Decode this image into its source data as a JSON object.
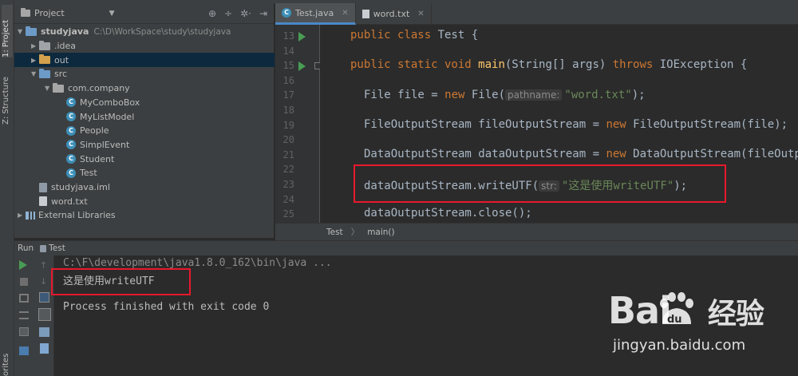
{
  "sidebar": {
    "project_tab": "1: Project",
    "structure_tab": "Z: Structure",
    "favorites_tab": "orites"
  },
  "project": {
    "header": "Project",
    "tree": [
      {
        "label": "studyjava",
        "path": "C:\\D\\WorkSpace\\study\\studyjava",
        "icon": "module-folder-icon",
        "arrow": "▼",
        "indent": 0
      },
      {
        "label": ".idea",
        "icon": "folder-icon",
        "arrow": "▶",
        "indent": 1
      },
      {
        "label": "out",
        "icon": "excluded-folder-icon",
        "arrow": "▶",
        "indent": 1,
        "selected": true
      },
      {
        "label": "src",
        "icon": "source-folder-icon",
        "arrow": "▼",
        "indent": 1
      },
      {
        "label": "com.company",
        "icon": "package-icon",
        "arrow": "▼",
        "indent": 2
      },
      {
        "label": "MyComboBox",
        "icon": "class-icon",
        "indent": 3
      },
      {
        "label": "MyListModel",
        "icon": "class-icon",
        "indent": 3
      },
      {
        "label": "People",
        "icon": "class-icon",
        "indent": 3
      },
      {
        "label": "SimplEvent",
        "icon": "class-icon",
        "indent": 3
      },
      {
        "label": "Student",
        "icon": "class-icon",
        "indent": 3
      },
      {
        "label": "Test",
        "icon": "class-icon",
        "indent": 3
      },
      {
        "label": "studyjava.iml",
        "icon": "iml-file-icon",
        "indent": 1
      },
      {
        "label": "word.txt",
        "icon": "text-file-icon",
        "indent": 1
      },
      {
        "label": "External Libraries",
        "icon": "libraries-icon",
        "arrow": "▶",
        "indent": 0
      }
    ]
  },
  "editor": {
    "tabs": [
      {
        "label": "Test.java",
        "active": true
      },
      {
        "label": "word.txt",
        "active": false
      }
    ],
    "line_numbers": [
      "13",
      "14",
      "15",
      "16",
      "17",
      "18",
      "19",
      "20",
      "21",
      "22",
      "23",
      "24",
      "25"
    ],
    "code": {
      "l13_kw": "public class ",
      "l13_rest": "Test {",
      "l15_kw": "public static void ",
      "l15_fn": "main",
      "l15_mid": "(String[] args) ",
      "l15_kw2": "throws ",
      "l15_rest": "IOException {",
      "l17_a": "File file = ",
      "l17_kw": "new ",
      "l17_b": "File(",
      "l17_hint": "pathname:",
      "l17_str": "\"word.txt\"",
      "l17_end": ");",
      "l19_a": "FileOutputStream fileOutputStream = ",
      "l19_kw": "new ",
      "l19_b": "FileOutputStream(file);",
      "l21_a": "DataOutputStream dataOutputStream = ",
      "l21_kw": "new ",
      "l21_b": "DataOutputStream(fileOutp",
      "l23_a": "dataOutputStream.writeUTF(",
      "l23_hint": "str:",
      "l23_str": "\"这是使用writeUTF\"",
      "l23_end": ");",
      "l25": "dataOutputStream.close();"
    }
  },
  "breadcrumb": [
    "Test",
    "main()"
  ],
  "run": {
    "label": "Run",
    "tab": "Test",
    "console": {
      "command": "C:\\F\\development\\java1.8.0_162\\bin\\java ...",
      "output": "这是使用writeUTF",
      "finished": "Process finished with exit code 0"
    }
  },
  "watermark": {
    "logo": "Bai",
    "logo_tail": "经验",
    "logo_du": "du",
    "url": "jingyan.baidu.com"
  },
  "colors": {
    "accent": "#4a88c7",
    "highlight": "#e8192c",
    "keyword": "#cc7832",
    "string": "#6a8759"
  }
}
